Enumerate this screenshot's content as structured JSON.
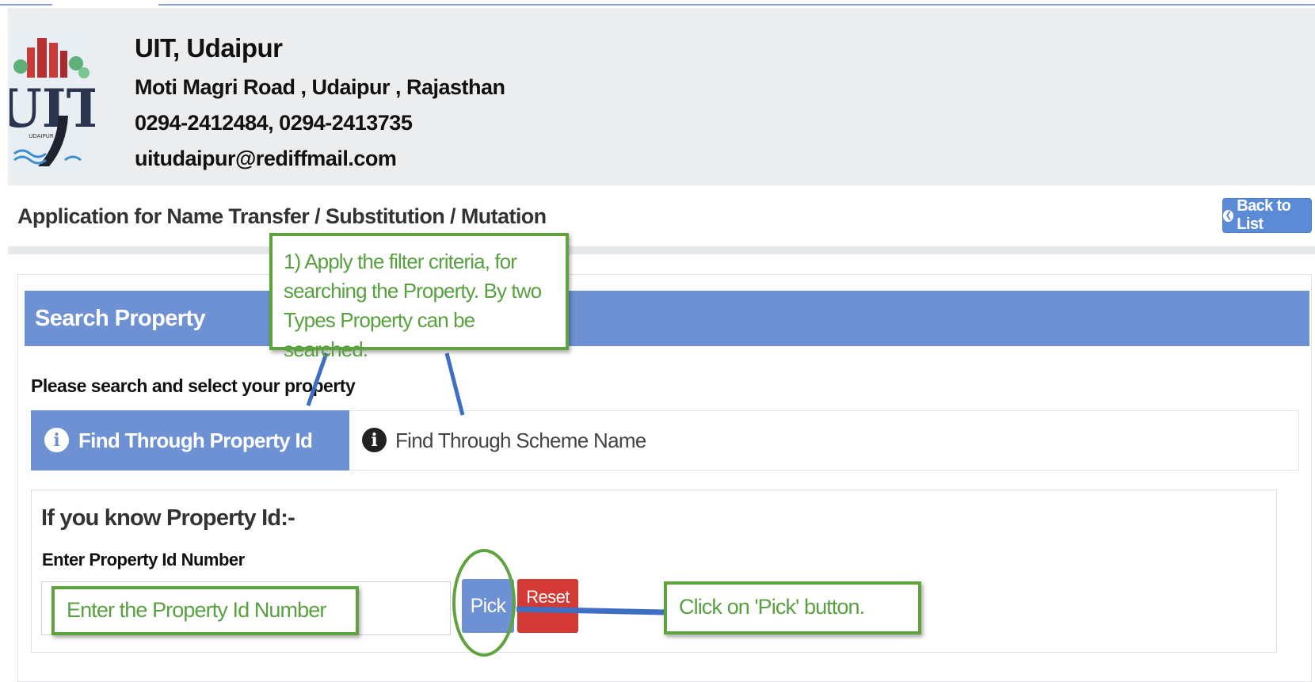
{
  "header": {
    "org_title": "UIT, Udaipur",
    "address": "Moti Magri Road , Udaipur , Rajasthan",
    "phone": "0294-2412484, 0294-2413735",
    "email": "uitudaipur@rediffmail.com",
    "logo_text": "UIT",
    "logo_subtext": "UDAIPUR"
  },
  "page": {
    "title": "Application for Name Transfer / Substitution / Mutation",
    "back_button": "Back to List"
  },
  "search_panel": {
    "title": "Search Property",
    "prompt": "Please search and select your property",
    "tabs": [
      {
        "label": "Find Through Property Id",
        "active": true,
        "icon": "info-icon"
      },
      {
        "label": "Find Through Scheme Name",
        "active": false,
        "icon": "info-icon"
      }
    ],
    "form": {
      "heading": "If you know Property Id:-",
      "field_label": "Enter Property Id Number",
      "input_value": "",
      "pick_button": "Pick",
      "reset_button": "Reset"
    }
  },
  "annotations": {
    "filter_note": "1) Apply the filter criteria, for searching the Property. By two Types Property can be searched.",
    "input_note": "Enter the Property Id Number",
    "pick_note": "Click on 'Pick' button."
  },
  "colors": {
    "accent_blue": "#6e91d4",
    "reset_red": "#d43a35",
    "callout_green": "#5fa33f",
    "arrow_blue": "#3f6fc4"
  }
}
